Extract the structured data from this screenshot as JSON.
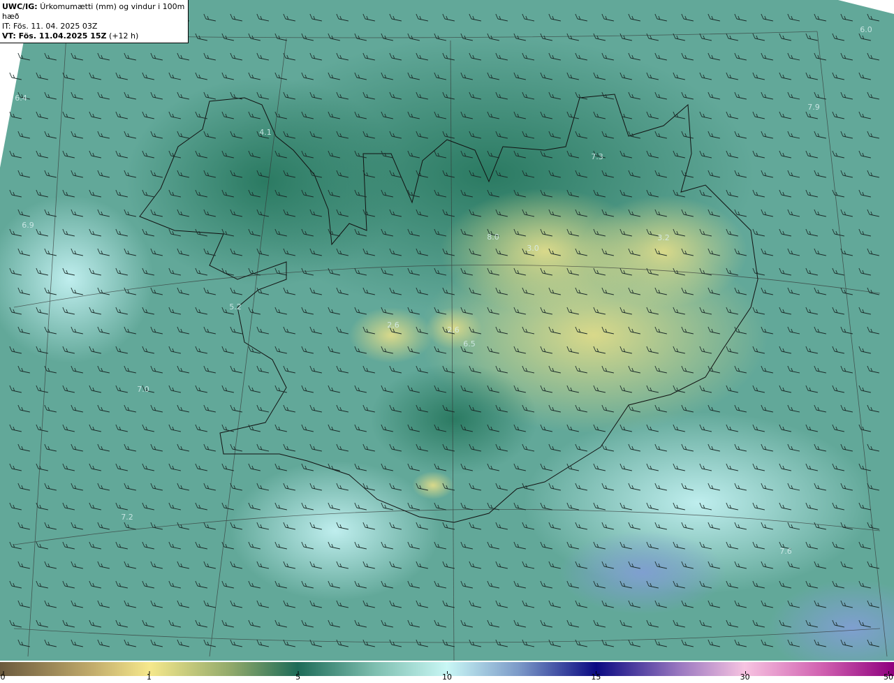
{
  "header": {
    "model_label": "UWC/IG:",
    "field_title": "Úrkomumætti (mm) og vindur i 100m hæð",
    "init_time": "IT: Fös. 11. 04. 2025 03Z",
    "valid_label": "VT: Fös. 11.04.2025 15Z",
    "lead": "(+12 h)"
  },
  "colorbar": {
    "ticks": [
      "0",
      "1",
      "5",
      "10",
      "15",
      "30",
      "50"
    ],
    "colors": [
      "#6b5a3e",
      "#f6e88c",
      "#1d6b58",
      "#c9f7f5",
      "#0b0a82",
      "#f7c3e1",
      "#8e007e"
    ]
  },
  "map": {
    "background_color": "#5fa596",
    "values": [
      {
        "t": "6.0"
      },
      {
        "t": "6.4"
      },
      {
        "t": "4.1"
      },
      {
        "t": "7.9"
      },
      {
        "t": "7.3"
      },
      {
        "t": "6.9"
      },
      {
        "t": "8.0"
      },
      {
        "t": "3.0"
      },
      {
        "t": "3.2"
      },
      {
        "t": "5.2"
      },
      {
        "t": "2.6"
      },
      {
        "t": "2.6"
      },
      {
        "t": "6.5"
      },
      {
        "t": "7.0"
      },
      {
        "t": "7.2"
      },
      {
        "t": "7.6"
      }
    ]
  }
}
